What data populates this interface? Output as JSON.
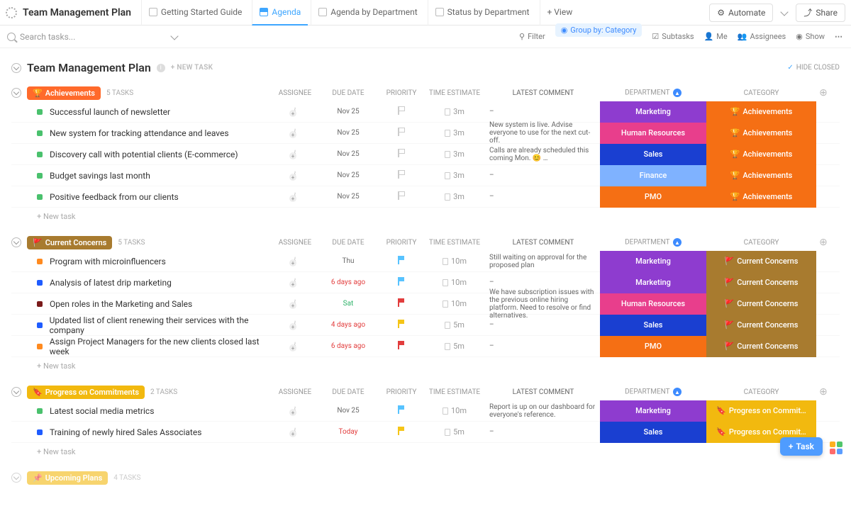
{
  "workspace": {
    "title": "Team Management Plan"
  },
  "tabs": [
    {
      "label": "Getting Started Guide",
      "active": false
    },
    {
      "label": "Agenda",
      "active": true
    },
    {
      "label": "Agenda by Department",
      "active": false
    },
    {
      "label": "Status by Department",
      "active": false
    }
  ],
  "addView": "+ View",
  "topRight": {
    "automate": "Automate",
    "share": "Share"
  },
  "toolbar": {
    "searchPlaceholder": "Search tasks...",
    "filter": "Filter",
    "groupBy": "Group by: Category",
    "subtasks": "Subtasks",
    "me": "Me",
    "assignees": "Assignees",
    "show": "Show"
  },
  "page": {
    "title": "Team Management Plan",
    "newTask": "+ NEW TASK",
    "hideClosed": "HIDE CLOSED"
  },
  "columns": {
    "assignee": "ASSIGNEE",
    "due": "DUE DATE",
    "priority": "PRIORITY",
    "estimate": "TIME ESTIMATE",
    "comment": "LATEST COMMENT",
    "department": "DEPARTMENT",
    "category": "CATEGORY"
  },
  "newTaskRow": "+ New task",
  "deptColors": {
    "Marketing": "#8e3ccf",
    "Human Resources": "#e83e8c",
    "Sales": "#1a3fd1",
    "Finance": "#7fb2ff",
    "PMO": "#f56f14"
  },
  "groups": [
    {
      "id": "g0",
      "name": "Achievements",
      "emoji": "🏆",
      "count": "5 TASKS",
      "pillColor": "#ff6a2b",
      "catColor": "#f56f14",
      "catEmoji": "🏆",
      "tasks": [
        {
          "sq": "#4ac16d",
          "title": "Successful launch of newsletter",
          "due": "Nov 25",
          "dueColor": "#6a6a6a",
          "flag": "outline",
          "est": "3m",
          "comment": "–",
          "dept": "Marketing"
        },
        {
          "sq": "#4ac16d",
          "title": "New system for tracking attendance and leaves",
          "due": "Nov 25",
          "dueColor": "#6a6a6a",
          "flag": "outline",
          "est": "3m",
          "comment": "New system is live. Advise everyone to use for the next cut-off.",
          "dept": "Human Resources"
        },
        {
          "sq": "#4ac16d",
          "title": "Discovery call with potential clients (E-commerce)",
          "due": "Nov 25",
          "dueColor": "#6a6a6a",
          "flag": "outline",
          "est": "3m",
          "comment": "Calls are already scheduled this coming Mon. 😊 …",
          "dept": "Sales"
        },
        {
          "sq": "#4ac16d",
          "title": "Budget savings last month",
          "due": "Nov 25",
          "dueColor": "#6a6a6a",
          "flag": "outline",
          "est": "3m",
          "comment": "–",
          "dept": "Finance"
        },
        {
          "sq": "#4ac16d",
          "title": "Positive feedback from our clients",
          "due": "Nov 25",
          "dueColor": "#6a6a6a",
          "flag": "outline",
          "est": "3m",
          "comment": "–",
          "dept": "PMO"
        }
      ]
    },
    {
      "id": "g1",
      "name": "Current Concerns",
      "emoji": "🚩",
      "count": "5 TASKS",
      "pillColor": "#a87b2f",
      "catColor": "#a87b2f",
      "catEmoji": "🚩",
      "tasks": [
        {
          "sq": "#ff8a1f",
          "title": "Program with microinfluencers",
          "due": "Thu",
          "dueColor": "#6a6a6a",
          "flag": "#58c3ff",
          "est": "10m",
          "comment": "Still waiting on approval for the proposed plan",
          "dept": "Marketing"
        },
        {
          "sq": "#1f5cff",
          "title": "Analysis of latest drip marketing",
          "due": "6 days ago",
          "dueColor": "#e23d3d",
          "flag": "#58c3ff",
          "est": "10m",
          "comment": "–",
          "dept": "Marketing"
        },
        {
          "sq": "#7a1b1b",
          "title": "Open roles in the Marketing and Sales",
          "due": "Sat",
          "dueColor": "#2fb36a",
          "flag": "#e23d3d",
          "est": "10m",
          "comment": "We have subscription issues with the previous online hiring platform. Need to resolve or find alternatives.",
          "dept": "Human Resources"
        },
        {
          "sq": "#1f5cff",
          "title": "Updated list of client renewing their services with the company",
          "due": "4 days ago",
          "dueColor": "#e23d3d",
          "flag": "#f5c518",
          "est": "5m",
          "comment": "–",
          "dept": "Sales"
        },
        {
          "sq": "#ff8a1f",
          "title": "Assign Project Managers for the new clients closed last week",
          "due": "6 days ago",
          "dueColor": "#e23d3d",
          "flag": "#e23d3d",
          "est": "5m",
          "comment": "–",
          "dept": "PMO"
        }
      ]
    },
    {
      "id": "g2",
      "name": "Progress on Commitments",
      "emoji": "🔖",
      "count": "2 TASKS",
      "pillColor": "#f2b90f",
      "catColor": "#f2b90f",
      "catEmoji": "🔖",
      "catShort": "Progress on Commit…",
      "tasks": [
        {
          "sq": "#4ac16d",
          "title": "Latest social media metrics",
          "due": "Nov 25",
          "dueColor": "#6a6a6a",
          "flag": "#58c3ff",
          "est": "10m",
          "comment": "Report is up on our dashboard for everyone's reference.",
          "dept": "Marketing"
        },
        {
          "sq": "#1f5cff",
          "title": "Training of newly hired Sales Associates",
          "due": "Today",
          "dueColor": "#e23d3d",
          "flag": "#f5c518",
          "est": "5m",
          "comment": "–",
          "dept": "Sales"
        }
      ]
    }
  ],
  "upcoming": {
    "name": "Upcoming Plans",
    "emoji": "📌",
    "count": "4 TASKS",
    "pillColor": "#f2b90f"
  },
  "fab": "Task"
}
